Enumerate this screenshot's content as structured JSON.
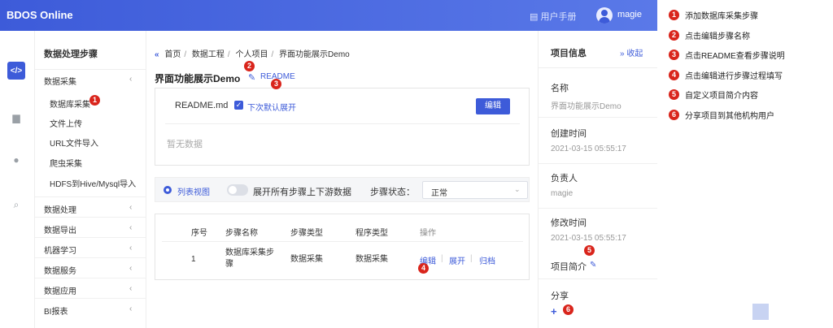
{
  "header": {
    "app_title": "BDOS Online",
    "manual_label": "用户手册",
    "user_name": "magie"
  },
  "rail": {
    "icons": [
      "code-icon",
      "folder-icon",
      "user-icon",
      "search-icon"
    ]
  },
  "sidebar": {
    "title": "数据处理步骤",
    "groups": [
      {
        "label": "数据采集",
        "expanded": true,
        "items": [
          "数据库采集",
          "文件上传",
          "URL文件导入",
          "爬虫采集",
          "HDFS到Hive/Mysql导入"
        ]
      },
      {
        "label": "数据处理"
      },
      {
        "label": "数据导出"
      },
      {
        "label": "机器学习"
      },
      {
        "label": "数据服务"
      },
      {
        "label": "数据应用"
      },
      {
        "label": "BI报表"
      }
    ]
  },
  "breadcrumb": [
    "首页",
    "数据工程",
    "个人项目",
    "界面功能展示Demo"
  ],
  "page": {
    "title": "界面功能展示Demo",
    "readme_link": "README"
  },
  "readme": {
    "file_name": "README.md",
    "default_expand_label": "下次默认展开",
    "edit_button": "编辑",
    "empty_text": "暂无数据"
  },
  "toolbar": {
    "view_label": "列表视图",
    "expand_label": "展开所有步骤上下游数据",
    "status_label": "步骤状态：",
    "status_value": "正常"
  },
  "table": {
    "headers": [
      "序号",
      "步骤名称",
      "步骤类型",
      "程序类型",
      "操作"
    ],
    "rows": [
      {
        "index": "1",
        "name_line1": "数据库采集步",
        "name_line2": "骤",
        "step_type": "数据采集",
        "program_type": "数据采集",
        "actions": [
          "编辑",
          "展开",
          "归档"
        ]
      }
    ]
  },
  "info": {
    "title": "项目信息",
    "collapse_label": "收起",
    "fields": [
      {
        "label": "名称",
        "value": "界面功能展示Demo"
      },
      {
        "label": "创建时间",
        "value": "2021-03-15 05:55:17"
      },
      {
        "label": "负责人",
        "value": "magie"
      },
      {
        "label": "修改时间",
        "value": "2021-03-15 05:55:17"
      }
    ],
    "intro_label": "项目简介",
    "share_label": "分享"
  },
  "badges": [
    "1",
    "2",
    "3",
    "4",
    "5",
    "6"
  ],
  "legend": [
    {
      "num": "1",
      "text": "添加数据库采集步骤"
    },
    {
      "num": "2",
      "text": "点击编辑步骤名称"
    },
    {
      "num": "3",
      "text": "点击README查看步骤说明"
    },
    {
      "num": "4",
      "text": "点击编辑进行步骤过程填写"
    },
    {
      "num": "5",
      "text": "自定义项目简介内容"
    },
    {
      "num": "6",
      "text": "分享项目到其他机构用户"
    }
  ],
  "colors": {
    "primary": "#3d5bd9",
    "badge": "#d9251c"
  }
}
